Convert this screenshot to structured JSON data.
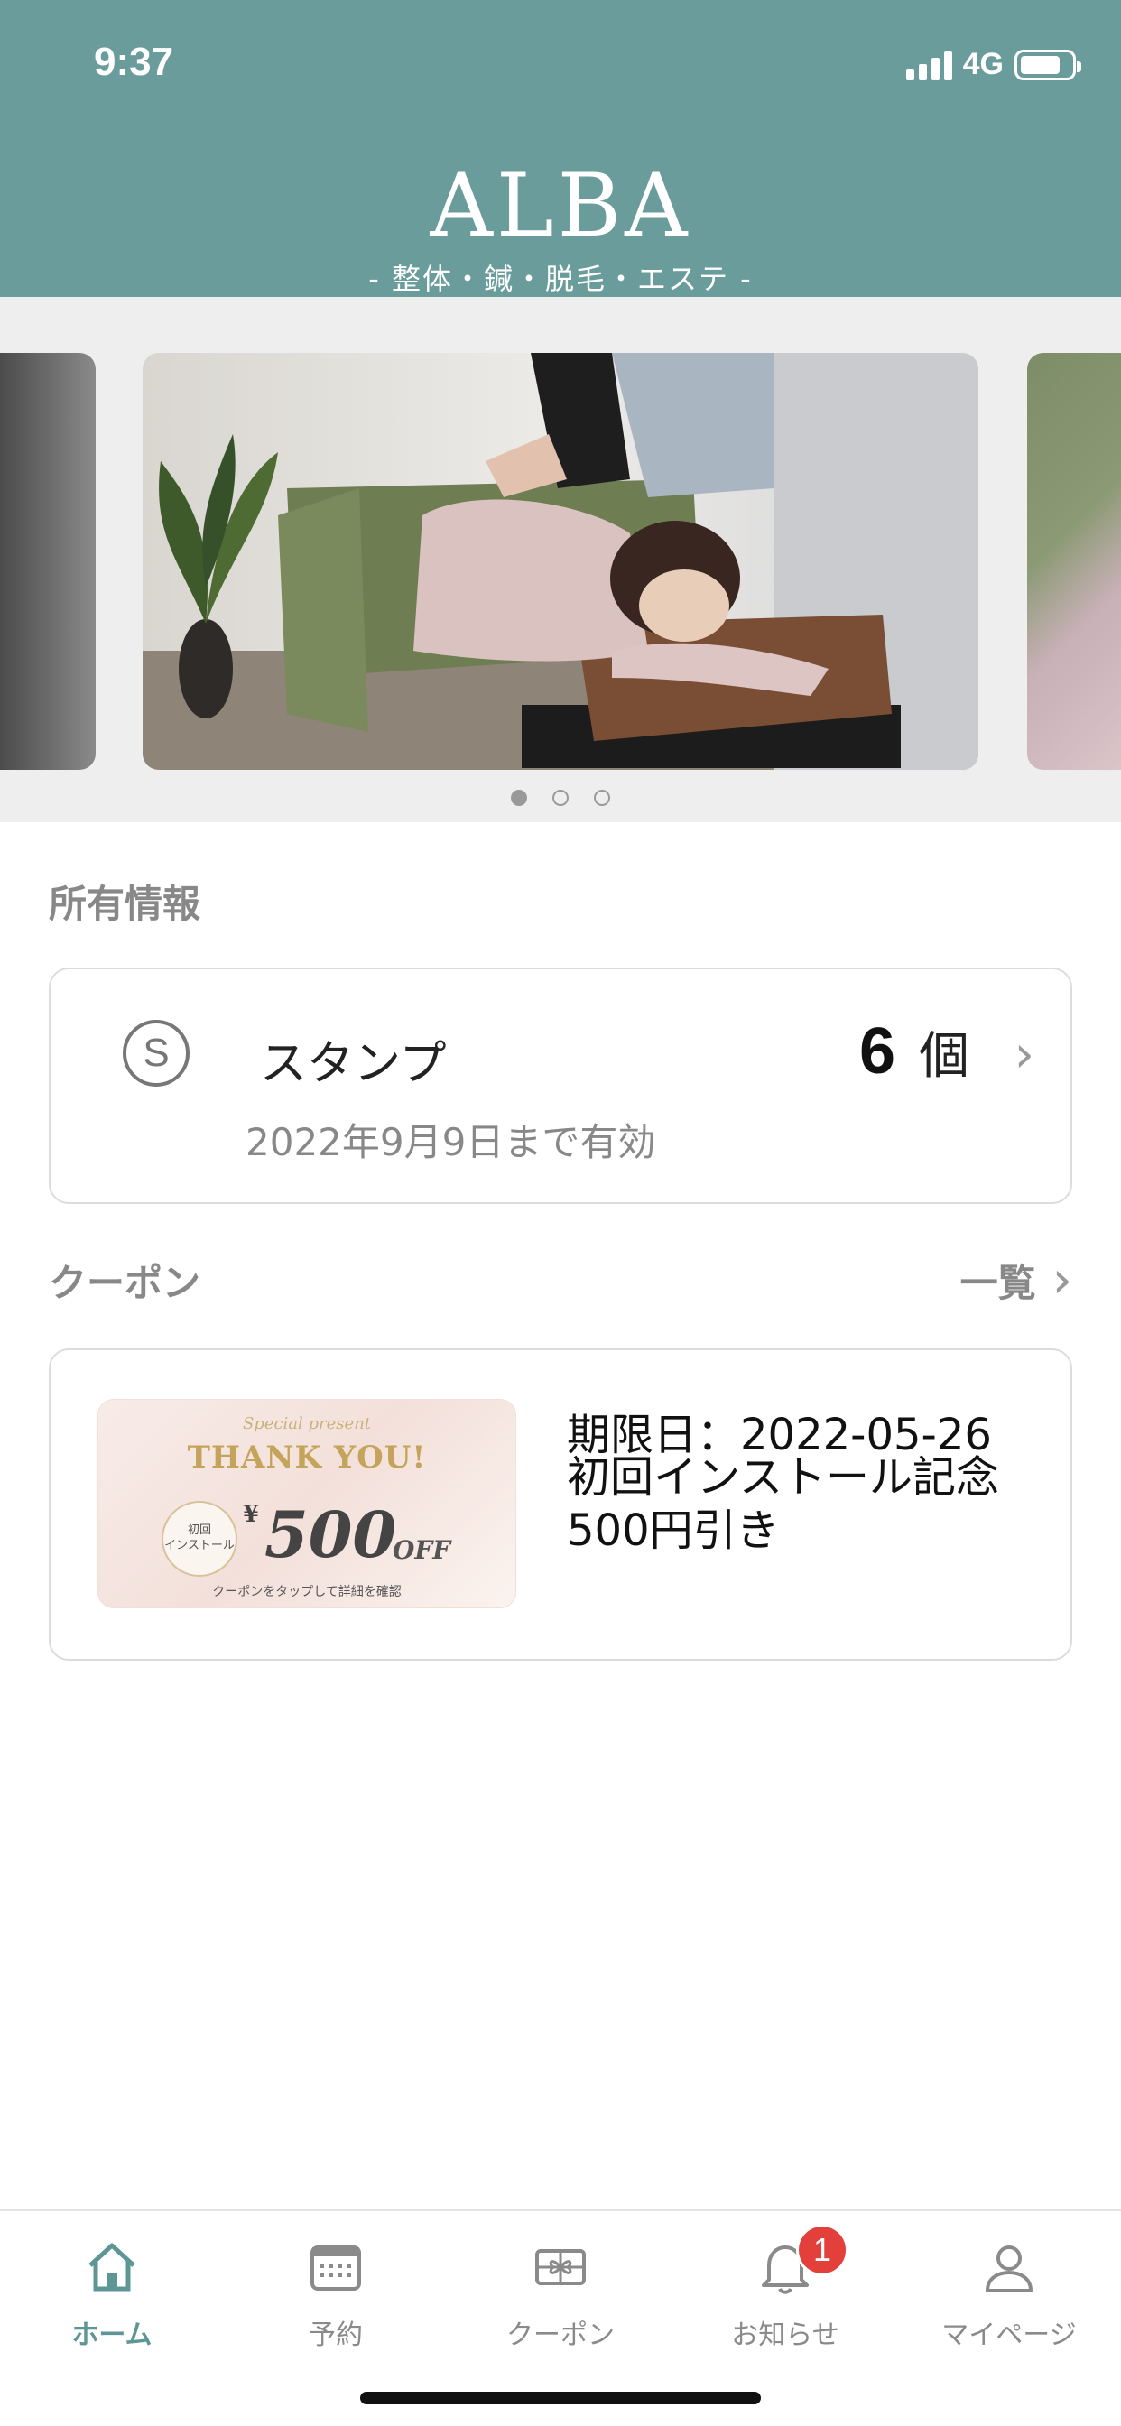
{
  "status_bar": {
    "time": "9:37",
    "network": "4G"
  },
  "header": {
    "brand": "ALBA",
    "tagline": "- 整体・鍼・脱毛・エステ -"
  },
  "carousel": {
    "slide_count": 3,
    "active_index": 0
  },
  "owned_info": {
    "section_title": "所有情報",
    "stamp": {
      "icon_letter": "S",
      "label": "スタンプ",
      "count": "6",
      "unit": "個",
      "valid_until": "2022年9月9日まで有効"
    }
  },
  "coupons": {
    "section_title": "クーポン",
    "list_link": "一覧",
    "items": [
      {
        "image": {
          "special": "Special present",
          "thanks": "THANK YOU!",
          "circle_line1": "初回",
          "circle_line2": "インストール",
          "yen": "¥",
          "amount": "500",
          "off": "OFF",
          "note": "クーポンをタップして詳細を確認"
        },
        "expiry": "期限日：2022-05-26",
        "title": "初回インストール記念500円引き"
      }
    ]
  },
  "tabbar": {
    "tabs": [
      {
        "label": "ホーム",
        "icon": "home-icon",
        "active": true
      },
      {
        "label": "予約",
        "icon": "calendar-icon"
      },
      {
        "label": "クーポン",
        "icon": "coupon-icon"
      },
      {
        "label": "お知らせ",
        "icon": "bell-icon",
        "badge": "1"
      },
      {
        "label": "マイページ",
        "icon": "person-icon"
      }
    ]
  },
  "colors": {
    "header": "#6a9c9c",
    "active_tab": "#5e9696",
    "badge": "#e3403b"
  }
}
